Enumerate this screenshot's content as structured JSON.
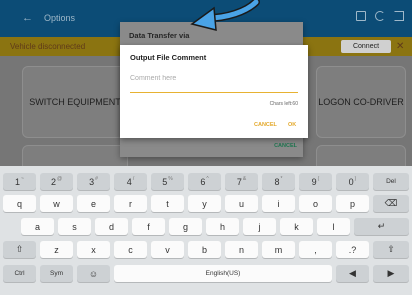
{
  "app": {
    "title": "Options",
    "status_message": "Vehicle disconnected",
    "connect_label": "Connect",
    "close_glyph": "✕",
    "back_glyph": "←",
    "tiles": [
      "SWITCH EQUIPMENT",
      "LOGON CO-DRIVER",
      "",
      ""
    ]
  },
  "transfer_dialog": {
    "title": "Data Transfer via",
    "cancel_label": "CANCEL"
  },
  "comment_dialog": {
    "title": "Output File Comment",
    "placeholder": "Comment here",
    "value": "",
    "counter": "Chars left:60",
    "cancel_label": "CANCEL",
    "ok_label": "OK",
    "accent_color": "#e3a82a"
  },
  "keyboard": {
    "row1": [
      {
        "main": "1",
        "alt": "~"
      },
      {
        "main": "2",
        "alt": "@"
      },
      {
        "main": "3",
        "alt": "#"
      },
      {
        "main": "4",
        "alt": "/"
      },
      {
        "main": "5",
        "alt": "%"
      },
      {
        "main": "6",
        "alt": "^"
      },
      {
        "main": "7",
        "alt": "&"
      },
      {
        "main": "8",
        "alt": "*"
      },
      {
        "main": "9",
        "alt": "("
      },
      {
        "main": "0",
        "alt": ")"
      },
      {
        "main": "Del",
        "alt": ""
      }
    ],
    "row2": [
      "q",
      "w",
      "e",
      "r",
      "t",
      "y",
      "u",
      "i",
      "o",
      "p",
      "⌫"
    ],
    "row3": [
      "a",
      "s",
      "d",
      "f",
      "g",
      "h",
      "j",
      "k",
      "l",
      "↵"
    ],
    "row4": [
      "⇧",
      "z",
      "x",
      "c",
      "v",
      "b",
      "n",
      "m",
      ",",
      ".?",
      "⇧"
    ],
    "row5": [
      "Ctrl",
      "Sym",
      "☺",
      "English(US)",
      "◀",
      "▶"
    ]
  },
  "icons": {
    "back": "arrow-left-icon",
    "topbar": [
      "window-icon",
      "refresh-icon",
      "logout-icon"
    ],
    "pointer": "curved-arrow-icon"
  }
}
